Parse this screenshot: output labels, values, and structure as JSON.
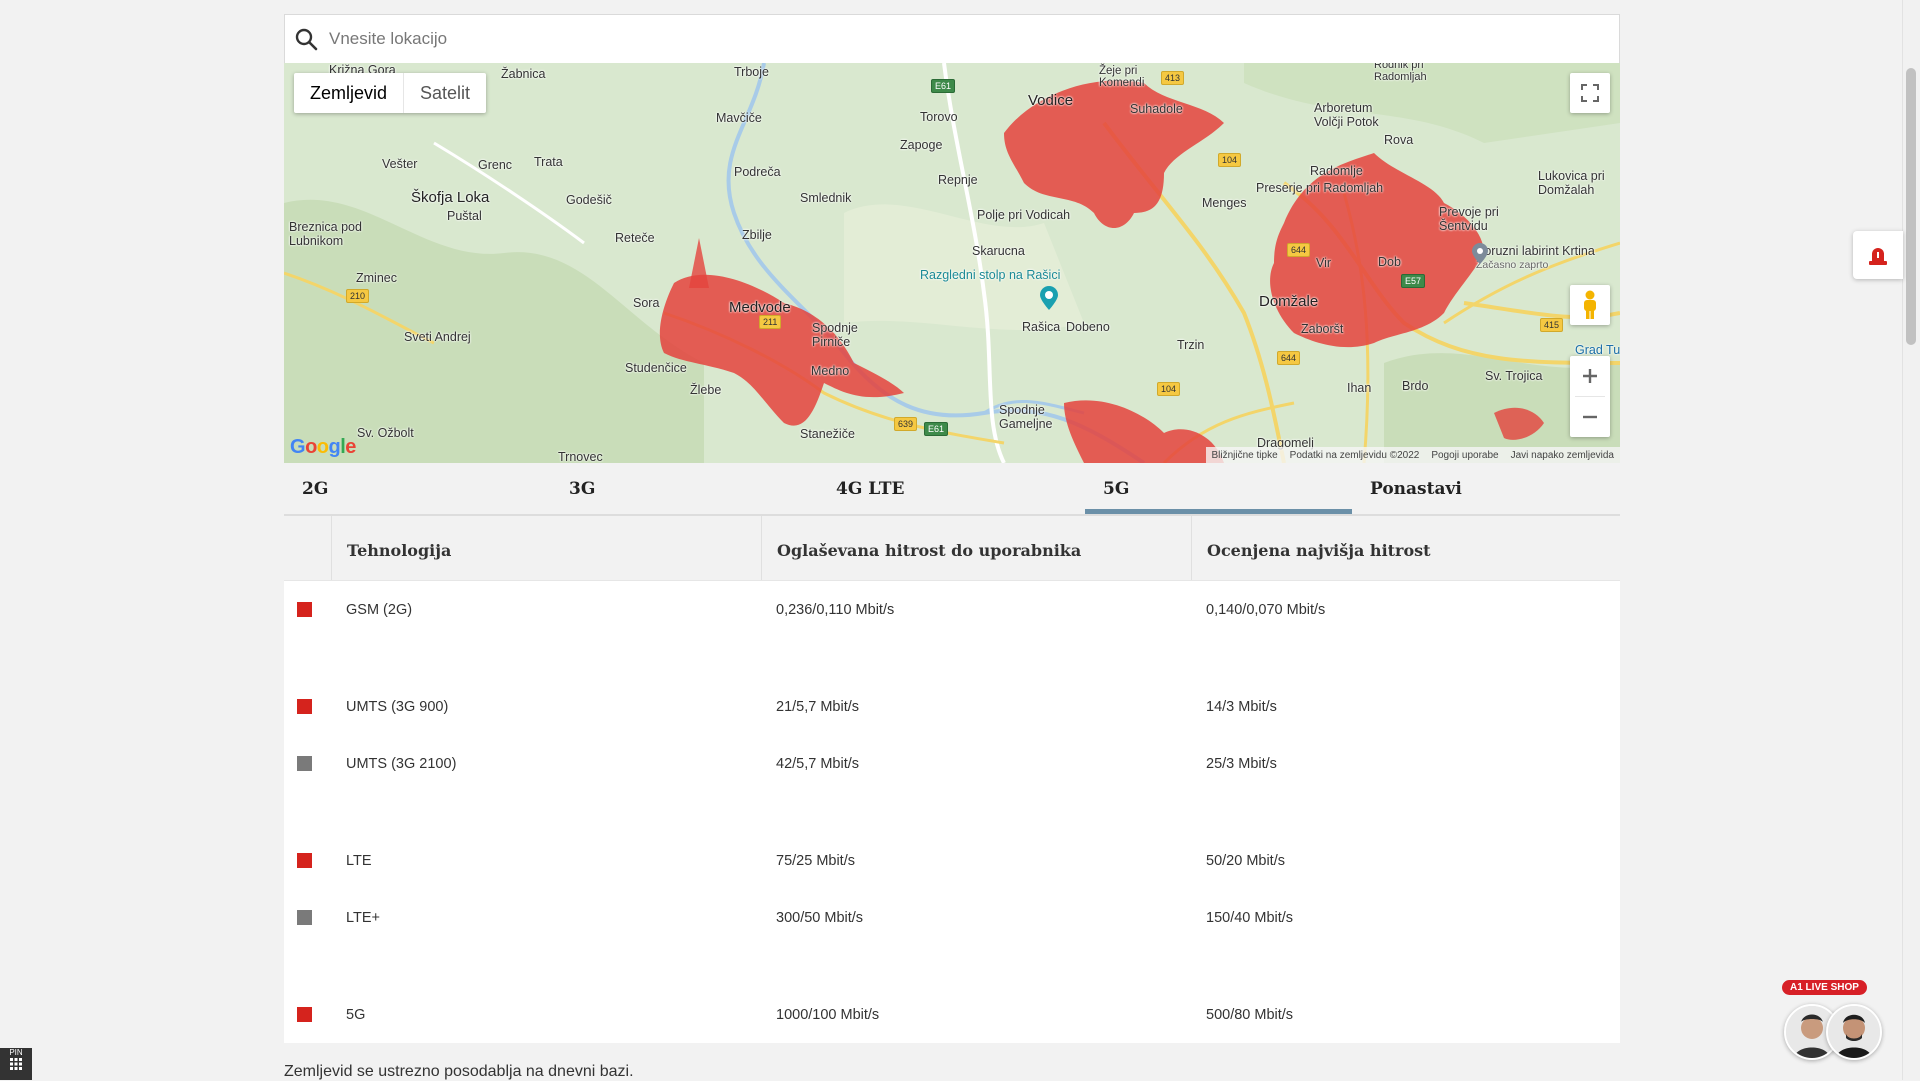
{
  "search": {
    "placeholder": "Vnesite lokacijo",
    "value": ""
  },
  "map": {
    "type_buttons": [
      "Zemljevid",
      "Satelit"
    ],
    "active_type": "Zemljevid",
    "coverage_color": "#e4433d",
    "labels": {
      "vodice": "Vodice",
      "medvode": "Medvode",
      "domzale": "Domžale",
      "skofja_loka": "Škofja Loka",
      "smlednik": "Smlednik",
      "preserje": "Preserje pri Radomljah",
      "radomlje": "Radomlje",
      "menges": "Menges",
      "vir": "Vir",
      "dob": "Dob",
      "trzin": "Trzin",
      "zaborst": "Zaboršt",
      "ihan": "Ihan",
      "brdo": "Brdo",
      "razgledni": "Razgledni stolp na Rašici",
      "rasica": "Rašica",
      "dobeno": "Dobeno",
      "skarucna": "Skarucna",
      "polje": "Polje pri Vodicah",
      "repnje": "Repnje",
      "torovo": "Torovo",
      "zapoge": "Zapoge",
      "suhadole": "Suhadole",
      "arboretum": "Arboretum Volčji Potok",
      "rova": "Rova",
      "lukovica": "Lukovica pri Domžalah",
      "prevoje": "Prevoje pri Šentvidu",
      "koruzni": "Koruzni labirint Krtina",
      "koruzni_sub": "Začasno zaprto",
      "grad": "Grad Tu",
      "zbilje": "Zbilje",
      "retece": "Reteče",
      "sora": "Sora",
      "podreca": "Podreča",
      "mavcice": "Mavčiče",
      "trboje": "Trboje",
      "zabnica": "Žabnica",
      "krizna": "Križna Gora",
      "vester": "Vešter",
      "grenc": "Grenc",
      "trata": "Trata",
      "godesic": "Godešič",
      "pustal": "Puštal",
      "breznica": "Breznica pod Lubnikom",
      "zminec": "Zminec",
      "sveti_andrej": "Sveti Andrej",
      "studencice": "Studenčice",
      "zlebe": "Žlebe",
      "medno": "Medno",
      "stanezice": "Stanežiče",
      "spodnje_pirnice": "Spodnje Pirniče",
      "spodnje_gamelje": "Spodnje Gameljne",
      "sv_ozbolt": "Sv. Ožbolt",
      "trnovec": "Trnovec",
      "dragomelj": "Dragomelj",
      "sv_trojica": "Sv. Trojica",
      "zeje": "Žeje pri Komendi",
      "rodnik": "Rodnik pri Radomljah"
    },
    "roads": [
      "E61",
      "413",
      "104",
      "210",
      "211",
      "644",
      "E57",
      "415",
      "104",
      "639",
      "E61",
      "644"
    ],
    "google_logo": "Google",
    "attribution": [
      "Bližnjične tipke",
      "Podatki na zemljevidu ©2022",
      "Pogoji uporabe",
      "Javi napako zemljevida"
    ]
  },
  "tabs": [
    {
      "label": "2G",
      "active": false
    },
    {
      "label": "3G",
      "active": false
    },
    {
      "label": "4G LTE",
      "active": false
    },
    {
      "label": "5G",
      "active": true
    },
    {
      "label": "Ponastavi",
      "active": false
    }
  ],
  "table": {
    "headers": [
      "Tehnologija",
      "Oglaševana hitrost do uporabnika",
      "Ocenjena najvišja hitrost"
    ],
    "rows": [
      {
        "color": "#d5231d",
        "tech": "GSM (2G)",
        "advertised": "0,236/0,110 Mbit/s",
        "estimated": "0,140/0,070 Mbit/s"
      },
      {
        "color": "#d5231d",
        "tech": "UMTS (3G 900)",
        "advertised": "21/5,7 Mbit/s",
        "estimated": "14/3 Mbit/s"
      },
      {
        "color": "#7a7a7a",
        "tech": "UMTS (3G 2100)",
        "advertised": "42/5,7 Mbit/s",
        "estimated": "25/3 Mbit/s"
      },
      {
        "color": "#d5231d",
        "tech": "LTE",
        "advertised": "75/25 Mbit/s",
        "estimated": "50/20 Mbit/s"
      },
      {
        "color": "#7a7a7a",
        "tech": "LTE+",
        "advertised": "300/50 Mbit/s",
        "estimated": "150/40 Mbit/s"
      },
      {
        "color": "#d5231d",
        "tech": "5G",
        "advertised": "1000/100 Mbit/s",
        "estimated": "500/80 Mbit/s"
      }
    ]
  },
  "footer_note": "Zemljevid se ustrezno posodablja na dnevni bazi.",
  "liveshop": {
    "tag": "A1 LIVE SHOP"
  },
  "pin_badge": "PIN"
}
